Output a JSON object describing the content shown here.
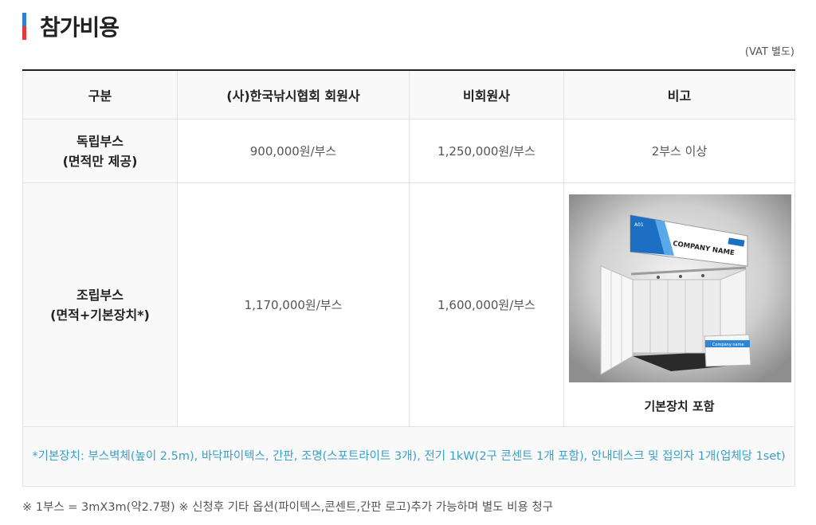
{
  "section": {
    "title": "참가비용",
    "vat_note": "(VAT 별도)"
  },
  "table": {
    "headers": [
      "구분",
      "(사)한국낚시협회 회원사",
      "비회원사",
      "비고"
    ],
    "rows": [
      {
        "category_line1": "독립부스",
        "category_line2": "(면적만 제공)",
        "member_price": "900,000원/부스",
        "nonmember_price": "1,250,000원/부스",
        "remark": "2부스 이상"
      },
      {
        "category_line1": "조립부스",
        "category_line2": "(면적+기본장치*)",
        "member_price": "1,170,000원/부스",
        "nonmember_price": "1,600,000원/부스",
        "remark_image_caption": "기본장치 포함",
        "booth_sign_text": "COMPANY NAME",
        "booth_badge": "A01",
        "booth_desk_text": "Company name"
      }
    ],
    "note": "*기본장치: 부스벽체(높이 2.5m), 바닥파이텍스, 간판, 조명(스포트라이트 3개), 전기 1kW(2구 콘센트 1개 포함), 안내데스크 및 접의자 1개(업체당 1set)"
  },
  "footnote": "※ 1부스 = 3mX3m(약2.7평) ※ 신청후 기타 옵션(파이텍스,콘센트,간판 로고)추가 가능하며 별도 비용 청구",
  "colors": {
    "accent_blue": "#2e7fd4",
    "accent_red": "#e63a3a",
    "note_text": "#3aa0c9"
  }
}
